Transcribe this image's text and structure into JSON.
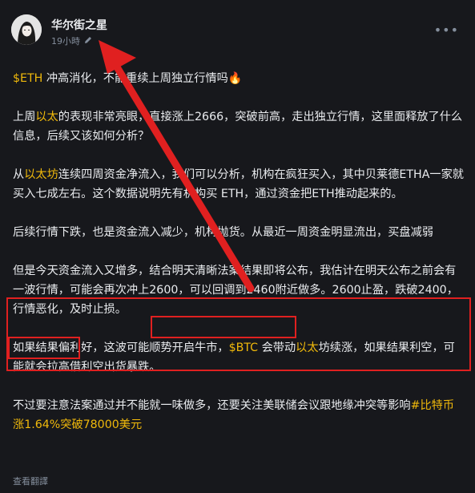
{
  "post": {
    "author": "华尔街之星",
    "time": "19小時",
    "translate_label": "查看翻譯"
  },
  "content": {
    "p1": {
      "ticker": "$ETH",
      "text": " 冲高消化，不能重续上周独立行情吗🔥"
    },
    "p2": {
      "pre": "上周",
      "tag": "以太",
      "post": "的表现非常亮眼，直接涨上2666，突破前高，走出独立行情，这里面释放了什么信息，后续又该如何分析？"
    },
    "p3": {
      "pre": "从",
      "tag": "以太坊",
      "post": "连续四周资金净流入，我们可以分析，机构在疯狂买入，其中贝莱德ETHA一家就买入七成左右。这个数据说明先有机构买 ETH，通过资金把ETH推动起来的。"
    },
    "p4": "后续行情下跌，也是资金流入减少，机构抛货。从最近一周资金明显流出，买盘减弱",
    "p5": {
      "a": "但是今天资金流入又增多，结合明天清晰法案结果即将公布，我估计在明天公布之前会有一波行情，",
      "b": "可能会再次冲上2600",
      "c": "，可以回调到2460附近做多。",
      "d": "2600止盈",
      "e": "，跌破2400，行情恶化，及时止损。"
    },
    "p6": {
      "pre": "如果结果偏利好，这波可能顺势开启牛市，",
      "ticker": "$BTC",
      "mid": " 会带动",
      "tag": "以太",
      "post": "坊续涨，如果结果利空，可能就会拉高借利空出货暴跌。"
    },
    "p7": {
      "pre": "不过要注意法案通过并不能就一味做多，还要关注美联储会议跟地缘冲突等影响",
      "tag": "#比特币涨1.64%突破78000美元"
    }
  },
  "colors": {
    "accent": "#f0b90b",
    "annotation": "#e02020",
    "background": "#17181c",
    "muted": "#848e9c"
  },
  "icons": {
    "edit": "pencil-icon",
    "more": "more-horizontal-icon"
  }
}
